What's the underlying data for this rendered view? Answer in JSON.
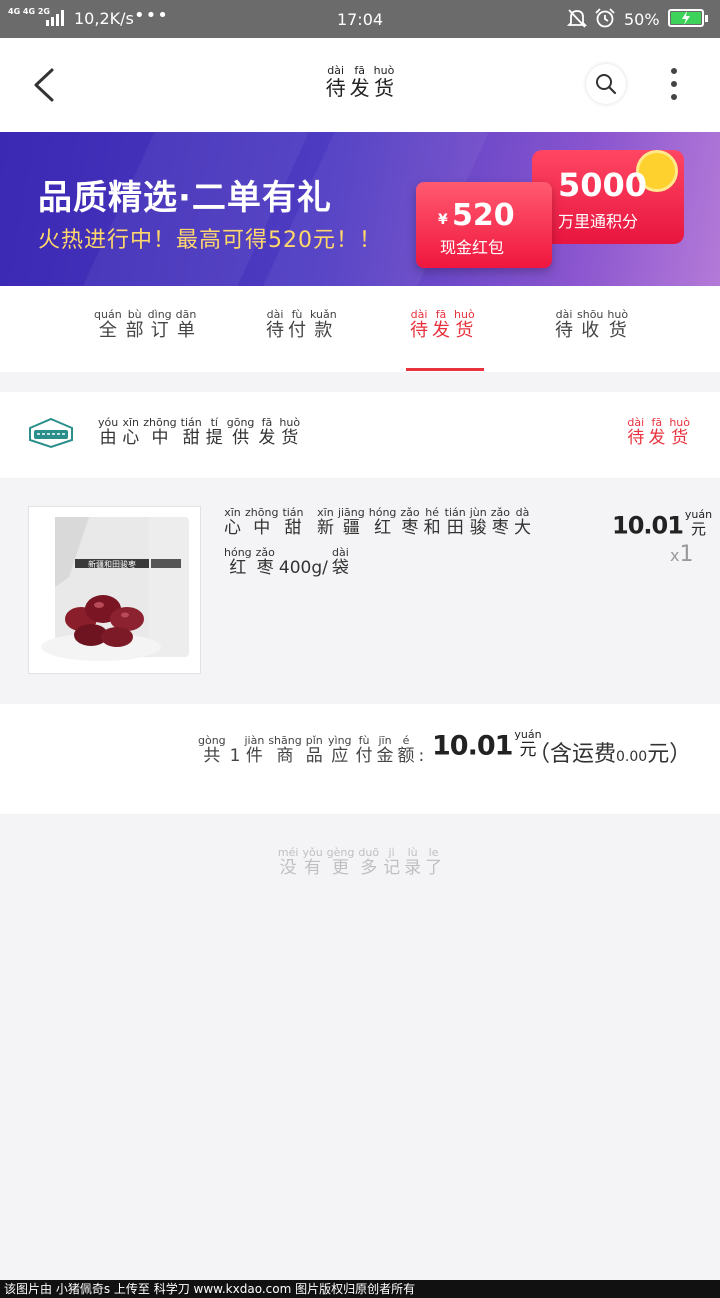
{
  "status_bar": {
    "network": "4G 4G 2G",
    "speed": "10,2K/s",
    "dots": "•••",
    "time": "17:04",
    "battery": "50%"
  },
  "header": {
    "title": [
      {
        "py": "dài",
        "hz": "待"
      },
      {
        "py": "fā",
        "hz": "发"
      },
      {
        "py": "huò",
        "hz": "货"
      }
    ]
  },
  "banner": {
    "title": "品质精选·二单有礼",
    "subtitle": "火热进行中！最高可得520元！！",
    "card_points": {
      "number": "5000",
      "label": "万里通积分"
    },
    "card_cash": {
      "currency": "¥",
      "number": "520",
      "label": "现金红包"
    }
  },
  "tabs": [
    {
      "chars": [
        {
          "py": "quán",
          "hz": "全"
        },
        {
          "py": "bù",
          "hz": "部"
        },
        {
          "py": "dìng",
          "hz": "订"
        },
        {
          "py": "dān",
          "hz": "单"
        }
      ],
      "active": false
    },
    {
      "chars": [
        {
          "py": "dài",
          "hz": "待"
        },
        {
          "py": "fù",
          "hz": "付"
        },
        {
          "py": "kuǎn",
          "hz": "款"
        }
      ],
      "active": false
    },
    {
      "chars": [
        {
          "py": "dài",
          "hz": "待"
        },
        {
          "py": "fā",
          "hz": "发"
        },
        {
          "py": "huò",
          "hz": "货"
        }
      ],
      "active": true
    },
    {
      "chars": [
        {
          "py": "dài",
          "hz": "待"
        },
        {
          "py": "shōu",
          "hz": "收"
        },
        {
          "py": "huò",
          "hz": "货"
        }
      ],
      "active": false
    }
  ],
  "shop": {
    "name": [
      {
        "py": "yóu",
        "hz": "由"
      },
      {
        "py": "xīn",
        "hz": "心"
      },
      {
        "py": "zhōng",
        "hz": "中"
      },
      {
        "py": "tián",
        "hz": "甜"
      },
      {
        "py": "tí",
        "hz": "提"
      },
      {
        "py": "gōng",
        "hz": "供"
      },
      {
        "py": "fā",
        "hz": "发"
      },
      {
        "py": "huò",
        "hz": "货"
      }
    ],
    "status": [
      {
        "py": "dài",
        "hz": "待"
      },
      {
        "py": "fā",
        "hz": "发"
      },
      {
        "py": "huò",
        "hz": "货"
      }
    ]
  },
  "product": {
    "name_line1": [
      {
        "py": "xīn",
        "hz": "心"
      },
      {
        "py": "zhōng",
        "hz": "中"
      },
      {
        "py": "tián",
        "hz": "甜"
      },
      {
        "py": "",
        "hz": " "
      },
      {
        "py": "xīn",
        "hz": "新"
      },
      {
        "py": "jiāng",
        "hz": "疆"
      },
      {
        "py": "hóng",
        "hz": "红"
      },
      {
        "py": "zǎo",
        "hz": "枣"
      },
      {
        "py": "hé",
        "hz": "和"
      },
      {
        "py": "tián",
        "hz": "田"
      },
      {
        "py": "jùn",
        "hz": "骏"
      },
      {
        "py": "zǎo",
        "hz": "枣"
      },
      {
        "py": "dà",
        "hz": "大"
      }
    ],
    "name_line2": [
      {
        "py": "hóng",
        "hz": "红"
      },
      {
        "py": "zǎo",
        "hz": "枣"
      },
      {
        "py": "",
        "hz": "400g/"
      },
      {
        "py": "dài",
        "hz": "袋"
      }
    ],
    "price_number": "10.01",
    "price_unit": {
      "py": "yuán",
      "hz": "元"
    },
    "qty_prefix": "x",
    "qty": "1",
    "image_alt_text": "新疆和田骏枣"
  },
  "summary": {
    "count": [
      {
        "py": "gòng",
        "hz": "共"
      },
      {
        "py": "",
        "hz": "1"
      },
      {
        "py": "jiàn",
        "hz": "件"
      },
      {
        "py": "shāng",
        "hz": "商"
      },
      {
        "py": "pǐn",
        "hz": "品"
      }
    ],
    "pay_label": [
      {
        "py": "yìng",
        "hz": "应"
      },
      {
        "py": "fù",
        "hz": "付"
      },
      {
        "py": "jīn",
        "hz": "金"
      },
      {
        "py": "é",
        "hz": "额"
      },
      {
        "py": "",
        "hz": ":"
      }
    ],
    "total_number": "10.01",
    "total_unit": {
      "py": "yuán",
      "hz": "元"
    },
    "shipping_prefix": "（含运费",
    "shipping_amount": "0.00",
    "shipping_suffix": "元）"
  },
  "no_more": [
    {
      "py": "méi",
      "hz": "没"
    },
    {
      "py": "yǒu",
      "hz": "有"
    },
    {
      "py": "gèng",
      "hz": "更"
    },
    {
      "py": "duō",
      "hz": "多"
    },
    {
      "py": "jì",
      "hz": "记"
    },
    {
      "py": "lù",
      "hz": "录"
    },
    {
      "py": "le",
      "hz": "了"
    }
  ],
  "footer": "该图片由 小猪佩奇s 上传至 科学刀 www.kxdao.com 图片版权归原创者所有",
  "colors": {
    "accent": "#e8323e",
    "banner_start": "#3b28b3",
    "banner_end": "#b47ad8"
  }
}
